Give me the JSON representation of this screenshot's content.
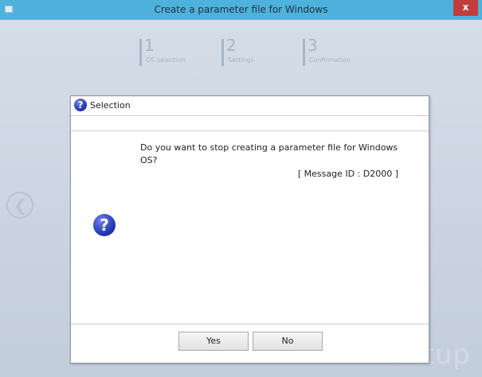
{
  "window": {
    "title": "Create a parameter file for Windows",
    "close_label": "x"
  },
  "steps": [
    {
      "num": "1",
      "label": "OS selection"
    },
    {
      "num": "2",
      "label": "Settings"
    },
    {
      "num": "3",
      "label": "Confirmation"
    }
  ],
  "watermark": "Setup",
  "dialog": {
    "title": "Selection",
    "message": "Do you want to stop creating a parameter file for Windows OS?",
    "message_id": "[ Message ID : D2000 ]",
    "yes_label": "Yes",
    "no_label": "No",
    "icon_glyph": "?"
  },
  "colors": {
    "titlebar": "#4fb2dd",
    "close_button": "#c43b3b",
    "background": "#c7d2de",
    "question_icon": "#2233b0"
  },
  "icons": [
    "window-icon",
    "close-icon",
    "back-arrow-icon",
    "question-icon"
  ]
}
